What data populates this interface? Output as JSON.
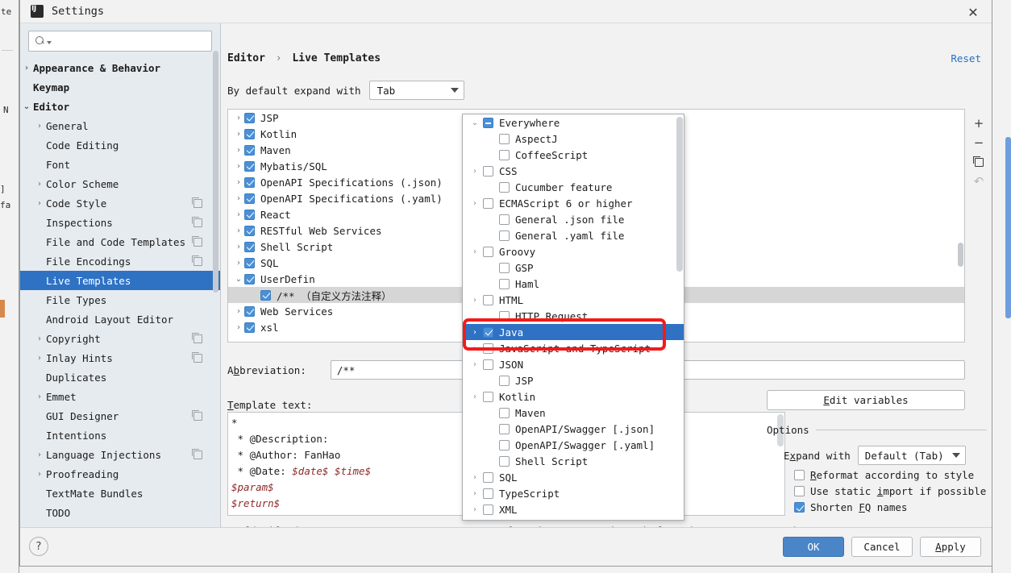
{
  "window": {
    "title": "Settings",
    "logo_icon": "intellij-idea-logo",
    "close_icon": "close-icon"
  },
  "background": {
    "fragments": [
      "te",
      "N",
      "]",
      "fa"
    ]
  },
  "search": {
    "value": "",
    "placeholder": "",
    "icon": "search-icon"
  },
  "sidebar": {
    "items": [
      {
        "label": "Appearance & Behavior",
        "level": 0,
        "arrow": "right",
        "bold": true,
        "selected": false,
        "copy": false
      },
      {
        "label": "Keymap",
        "level": 0,
        "arrow": "none",
        "bold": true,
        "selected": false,
        "copy": false
      },
      {
        "label": "Editor",
        "level": 0,
        "arrow": "down",
        "bold": true,
        "selected": false,
        "copy": false
      },
      {
        "label": "General",
        "level": 1,
        "arrow": "right",
        "bold": false,
        "selected": false,
        "copy": false
      },
      {
        "label": "Code Editing",
        "level": 1,
        "arrow": "none",
        "bold": false,
        "selected": false,
        "copy": false
      },
      {
        "label": "Font",
        "level": 1,
        "arrow": "none",
        "bold": false,
        "selected": false,
        "copy": false
      },
      {
        "label": "Color Scheme",
        "level": 1,
        "arrow": "right",
        "bold": false,
        "selected": false,
        "copy": false
      },
      {
        "label": "Code Style",
        "level": 1,
        "arrow": "right",
        "bold": false,
        "selected": false,
        "copy": true
      },
      {
        "label": "Inspections",
        "level": 1,
        "arrow": "none",
        "bold": false,
        "selected": false,
        "copy": true
      },
      {
        "label": "File and Code Templates",
        "level": 1,
        "arrow": "none",
        "bold": false,
        "selected": false,
        "copy": true
      },
      {
        "label": "File Encodings",
        "level": 1,
        "arrow": "none",
        "bold": false,
        "selected": false,
        "copy": true
      },
      {
        "label": "Live Templates",
        "level": 1,
        "arrow": "none",
        "bold": false,
        "selected": true,
        "copy": false
      },
      {
        "label": "File Types",
        "level": 1,
        "arrow": "none",
        "bold": false,
        "selected": false,
        "copy": false
      },
      {
        "label": "Android Layout Editor",
        "level": 1,
        "arrow": "none",
        "bold": false,
        "selected": false,
        "copy": false
      },
      {
        "label": "Copyright",
        "level": 1,
        "arrow": "right",
        "bold": false,
        "selected": false,
        "copy": true
      },
      {
        "label": "Inlay Hints",
        "level": 1,
        "arrow": "right",
        "bold": false,
        "selected": false,
        "copy": true
      },
      {
        "label": "Duplicates",
        "level": 1,
        "arrow": "none",
        "bold": false,
        "selected": false,
        "copy": false
      },
      {
        "label": "Emmet",
        "level": 1,
        "arrow": "right",
        "bold": false,
        "selected": false,
        "copy": false
      },
      {
        "label": "GUI Designer",
        "level": 1,
        "arrow": "none",
        "bold": false,
        "selected": false,
        "copy": true
      },
      {
        "label": "Intentions",
        "level": 1,
        "arrow": "none",
        "bold": false,
        "selected": false,
        "copy": false
      },
      {
        "label": "Language Injections",
        "level": 1,
        "arrow": "right",
        "bold": false,
        "selected": false,
        "copy": true
      },
      {
        "label": "Proofreading",
        "level": 1,
        "arrow": "right",
        "bold": false,
        "selected": false,
        "copy": false
      },
      {
        "label": "TextMate Bundles",
        "level": 1,
        "arrow": "none",
        "bold": false,
        "selected": false,
        "copy": false
      },
      {
        "label": "TODO",
        "level": 1,
        "arrow": "none",
        "bold": false,
        "selected": false,
        "copy": false
      }
    ]
  },
  "main": {
    "breadcrumb_parent": "Editor",
    "breadcrumb_sep": "›",
    "breadcrumb_current": "Live Templates",
    "reset_label": "Reset",
    "expand_label": "By default expand with",
    "expand_value": "Tab",
    "templates": [
      {
        "label": "JSP",
        "arrow": "right",
        "checked": true,
        "indent": false,
        "highlight": false
      },
      {
        "label": "Kotlin",
        "arrow": "right",
        "checked": true,
        "indent": false,
        "highlight": false
      },
      {
        "label": "Maven",
        "arrow": "right",
        "checked": true,
        "indent": false,
        "highlight": false
      },
      {
        "label": "Mybatis/SQL",
        "arrow": "right",
        "checked": true,
        "indent": false,
        "highlight": false
      },
      {
        "label": "OpenAPI Specifications (.json)",
        "arrow": "right",
        "checked": true,
        "indent": false,
        "highlight": false
      },
      {
        "label": "OpenAPI Specifications (.yaml)",
        "arrow": "right",
        "checked": true,
        "indent": false,
        "highlight": false
      },
      {
        "label": "React",
        "arrow": "right",
        "checked": true,
        "indent": false,
        "highlight": false
      },
      {
        "label": "RESTful Web Services",
        "arrow": "right",
        "checked": true,
        "indent": false,
        "highlight": false
      },
      {
        "label": "Shell Script",
        "arrow": "right",
        "checked": true,
        "indent": false,
        "highlight": false
      },
      {
        "label": "SQL",
        "arrow": "right",
        "checked": true,
        "indent": false,
        "highlight": false
      },
      {
        "label": "UserDefin",
        "arrow": "down",
        "checked": true,
        "indent": false,
        "highlight": false
      },
      {
        "label": "/** （自定义方法注释）",
        "arrow": "none",
        "checked": true,
        "indent": true,
        "highlight": true
      },
      {
        "label": "Web Services",
        "arrow": "right",
        "checked": true,
        "indent": false,
        "highlight": false
      },
      {
        "label": "xsl",
        "arrow": "right",
        "checked": true,
        "indent": false,
        "highlight": false
      }
    ],
    "list_tools": [
      {
        "icon": "plus-icon",
        "glyph": "+",
        "dim": false
      },
      {
        "icon": "minus-icon",
        "glyph": "−",
        "dim": false
      },
      {
        "icon": "copy-icon",
        "glyph": "",
        "dim": false
      },
      {
        "icon": "undo-icon",
        "glyph": "↶",
        "dim": true
      }
    ],
    "abbreviation_label_u": "b",
    "abbreviation_label_pre": "A",
    "abbreviation_label_post": "breviation:",
    "abbreviation_value": "/**",
    "template_text_label_u": "T",
    "template_text_label_post": "emplate text:",
    "template_text_lines": [
      {
        "text": "*",
        "var": false
      },
      {
        "text": " * @Description:",
        "var": false
      },
      {
        "text": " * @Author: FanHao",
        "var": false
      },
      {
        "prefix": " * @Date: ",
        "text": "$date$ $time$",
        "var": true
      },
      {
        "prefix": "",
        "text": "$param$",
        "var": true
      },
      {
        "prefix": "",
        "text": "$return$",
        "var": true
      },
      {
        "text": " */",
        "var": false
      }
    ],
    "applicable_text": "Applicable in Java; Java: statement, consumer function, expression, declaration, comment, string,.."
  },
  "options": {
    "edit_variables_u": "E",
    "edit_variables_post": "dit variables",
    "group_title": "Options",
    "expand_with_pre": "E",
    "expand_with_u": "x",
    "expand_with_post": "pand with",
    "expand_with_value": "Default (Tab)",
    "checkboxes": [
      {
        "pre": "",
        "u": "R",
        "post": "eformat according to style",
        "checked": false
      },
      {
        "pre": "Use static ",
        "u": "i",
        "post": "mport if possible",
        "checked": false
      },
      {
        "pre": "Shorten ",
        "u": "F",
        "post": "Q names",
        "checked": true
      }
    ]
  },
  "popup": {
    "items": [
      {
        "label": "Everywhere",
        "arrow": "down",
        "state": "tri",
        "indent": false,
        "selected": false
      },
      {
        "label": "AspectJ",
        "arrow": "none",
        "state": "off",
        "indent": true,
        "selected": false
      },
      {
        "label": "CoffeeScript",
        "arrow": "none",
        "state": "off",
        "indent": true,
        "selected": false
      },
      {
        "label": "CSS",
        "arrow": "right",
        "state": "off",
        "indent": false,
        "selected": false
      },
      {
        "label": "Cucumber feature",
        "arrow": "none",
        "state": "off",
        "indent": true,
        "selected": false
      },
      {
        "label": "ECMAScript 6 or higher",
        "arrow": "right",
        "state": "off",
        "indent": false,
        "selected": false
      },
      {
        "label": "General .json file",
        "arrow": "none",
        "state": "off",
        "indent": true,
        "selected": false
      },
      {
        "label": "General .yaml file",
        "arrow": "none",
        "state": "off",
        "indent": true,
        "selected": false
      },
      {
        "label": "Groovy",
        "arrow": "right",
        "state": "off",
        "indent": false,
        "selected": false
      },
      {
        "label": "GSP",
        "arrow": "none",
        "state": "off",
        "indent": true,
        "selected": false
      },
      {
        "label": "Haml",
        "arrow": "none",
        "state": "off",
        "indent": true,
        "selected": false
      },
      {
        "label": "HTML",
        "arrow": "right",
        "state": "off",
        "indent": false,
        "selected": false
      },
      {
        "label": "HTTP Request",
        "arrow": "none",
        "state": "off",
        "indent": true,
        "selected": false
      },
      {
        "label": "Java",
        "arrow": "right",
        "state": "on",
        "indent": false,
        "selected": true
      },
      {
        "label": "JavaScript and TypeScript",
        "arrow": "right",
        "state": "off",
        "indent": false,
        "selected": false
      },
      {
        "label": "JSON",
        "arrow": "right",
        "state": "off",
        "indent": false,
        "selected": false
      },
      {
        "label": "JSP",
        "arrow": "none",
        "state": "off",
        "indent": true,
        "selected": false
      },
      {
        "label": "Kotlin",
        "arrow": "right",
        "state": "off",
        "indent": false,
        "selected": false
      },
      {
        "label": "Maven",
        "arrow": "none",
        "state": "off",
        "indent": true,
        "selected": false
      },
      {
        "label": "OpenAPI/Swagger [.json]",
        "arrow": "none",
        "state": "off",
        "indent": true,
        "selected": false
      },
      {
        "label": "OpenAPI/Swagger [.yaml]",
        "arrow": "none",
        "state": "off",
        "indent": true,
        "selected": false
      },
      {
        "label": "Shell Script",
        "arrow": "none",
        "state": "off",
        "indent": true,
        "selected": false
      },
      {
        "label": "SQL",
        "arrow": "right",
        "state": "off",
        "indent": false,
        "selected": false
      },
      {
        "label": "TypeScript",
        "arrow": "right",
        "state": "off",
        "indent": false,
        "selected": false
      },
      {
        "label": "XML",
        "arrow": "right",
        "state": "off",
        "indent": false,
        "selected": false
      }
    ]
  },
  "annotation": {
    "color": "#f41a1a",
    "target": "Java"
  },
  "footer": {
    "help_icon": "question-mark-icon",
    "ok_label": "OK",
    "cancel_label": "Cancel",
    "apply_pre": "",
    "apply_u": "A",
    "apply_post": "pply"
  }
}
